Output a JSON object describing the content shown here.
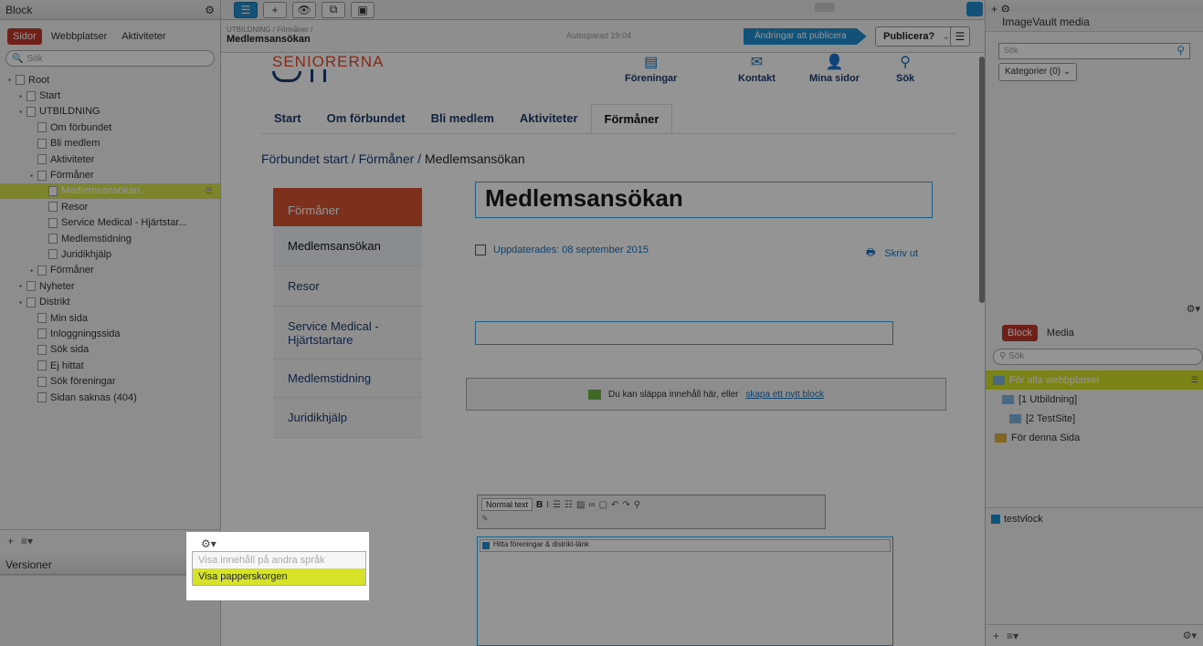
{
  "left": {
    "header_title": "Block",
    "tabs": [
      "Sidor",
      "Webbplatser",
      "Aktiviteter"
    ],
    "search_placeholder": "Sök",
    "tree": [
      {
        "label": "Root",
        "level": 0
      },
      {
        "label": "Start",
        "level": 1
      },
      {
        "label": "UTBILDNING",
        "level": 1
      },
      {
        "label": "Om förbundet",
        "level": 2
      },
      {
        "label": "Bli medlem",
        "level": 2
      },
      {
        "label": "Aktiviteter",
        "level": 2
      },
      {
        "label": "Förmåner",
        "level": 2
      },
      {
        "label": "Medlemsansökan",
        "level": 3,
        "selected": true
      },
      {
        "label": "Resor",
        "level": 3
      },
      {
        "label": "Service Medical - Hjärtstar...",
        "level": 3
      },
      {
        "label": "Medlemstidning",
        "level": 3
      },
      {
        "label": "Juridikhjälp",
        "level": 3
      },
      {
        "label": "Förmåner",
        "level": 2
      },
      {
        "label": "Nyheter",
        "level": 1
      },
      {
        "label": "Distrikt",
        "level": 1
      },
      {
        "label": "Min sida",
        "level": 2
      },
      {
        "label": "Inloggningssida",
        "level": 2
      },
      {
        "label": "Sök sida",
        "level": 2
      },
      {
        "label": "Ej hittat",
        "level": 2
      },
      {
        "label": "Sök föreningar",
        "level": 2
      },
      {
        "label": "Sidan saknas (404)",
        "level": 2
      }
    ],
    "versions_title": "Versioner"
  },
  "popup": {
    "items": [
      "Visa innehåll på andra språk",
      "Visa papperskorgen"
    ]
  },
  "editor": {
    "breadcrumb": "UTBILDNING / Förmåner /",
    "page_title": "Medlemsansökan",
    "autosave": "Autosparad 19:04",
    "changes_label": "Ändringar att publicera",
    "publish_label": "Publicera?"
  },
  "site": {
    "logo_text": "SENIORERNA",
    "top_icons": [
      {
        "label": "Föreningar",
        "icon": "document-icon"
      },
      {
        "label": "Kontakt",
        "icon": "mail-icon"
      },
      {
        "label": "Mina sidor",
        "icon": "user-icon"
      },
      {
        "label": "Sök",
        "icon": "search-icon"
      }
    ],
    "nav": [
      "Start",
      "Om förbundet",
      "Bli medlem",
      "Aktiviteter",
      "Förmåner"
    ],
    "breadcrumb": [
      "Förbundet start",
      "Förmåner",
      "Medlemsansökan"
    ],
    "side_head": "Förmåner",
    "side_items": [
      "Medlemsansökan",
      "Resor",
      "Service Medical - Hjärtstartare",
      "Medlemstidning",
      "Juridikhjälp"
    ],
    "heading": "Medlemsansökan",
    "updated": "Uppdaterades: 08 september 2015",
    "print": "Skriv ut",
    "dropzone_text": "Du kan släppa innehåll här, eller",
    "dropzone_link": "skapa ett nytt block",
    "rte_format": "Normal text",
    "rte_line": "Hitta föreningar & distrikt-länk"
  },
  "right": {
    "title": "ImageVault media",
    "search_placeholder": "Sök",
    "categories": "Kategorier (0)",
    "tabs": [
      "Block",
      "Media"
    ],
    "search2_placeholder": "Sök",
    "items": [
      {
        "label": "För alla webbplatser",
        "selected": true
      },
      {
        "label": "[1 Utbildning]"
      },
      {
        "label": "[2 TestSite]"
      },
      {
        "label": "För denna Sida"
      }
    ],
    "block_item": "testvlock"
  }
}
